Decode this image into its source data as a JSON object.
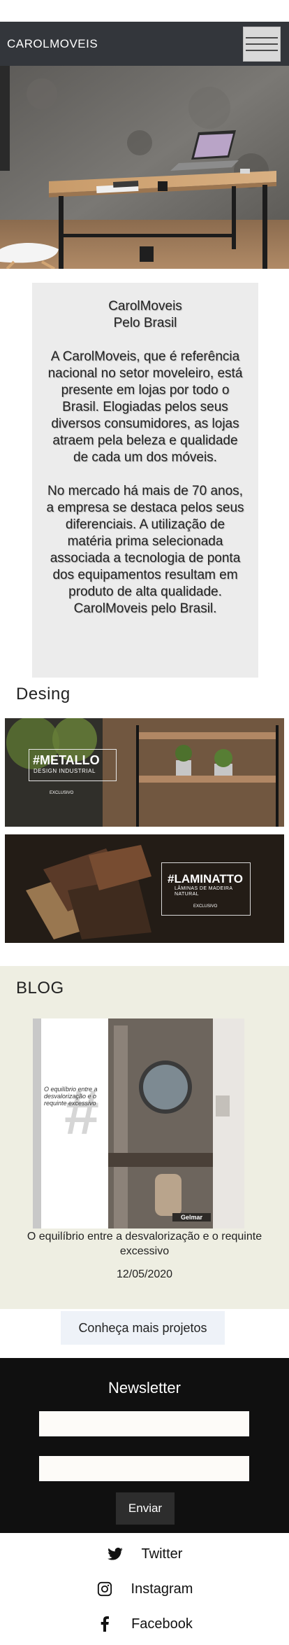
{
  "header": {
    "brand": "CAROLMOVEIS",
    "menu_icon": "hamburger-menu-icon"
  },
  "intro": {
    "line1": "CarolMoveis",
    "line2": "Pelo Brasil",
    "paragraph1": "A CarolMoveis, que é referência nacional no setor moveleiro, está presente em lojas por todo o Brasil. Elogiadas pelos seus diversos consumidores, as lojas atraem pela beleza e qualidade de cada um dos móveis.",
    "paragraph2": "No mercado há mais de 70 anos, a empresa se destaca pelos seus diferenciais. A utilização de matéria prima selecionada associada a tecnologia de ponta dos equipamentos resultam em produto de alta qualidade. CarolMoveis pelo Brasil."
  },
  "design": {
    "title": "Desing",
    "banners": [
      {
        "title": "#METALLO",
        "subtitle": "DESIGN INDUSTRIAL",
        "tag": "EXCLUSIVO"
      },
      {
        "title": "#LAMINATTO",
        "subtitle": "LÂMINAS DE MADEIRA\nNATURAL",
        "tag": "EXCLUSIVO"
      }
    ]
  },
  "blog": {
    "title": "BLOG",
    "post": {
      "image_text": "O equilíbrio entre a desvalorização e o requinte excessivo",
      "caption": "O equilíbrio entre a desvalorização e o requinte excessivo",
      "date": "12/05/2020",
      "logo": "Gelmar"
    }
  },
  "more_button": "Conheça mais projetos",
  "newsletter": {
    "title": "Newsletter",
    "field1_placeholder": "",
    "field2_placeholder": "",
    "submit": "Enviar"
  },
  "social": [
    {
      "label": "Twitter",
      "icon": "twitter-icon"
    },
    {
      "label": "Instagram",
      "icon": "instagram-icon"
    },
    {
      "label": "Facebook",
      "icon": "facebook-icon"
    }
  ]
}
